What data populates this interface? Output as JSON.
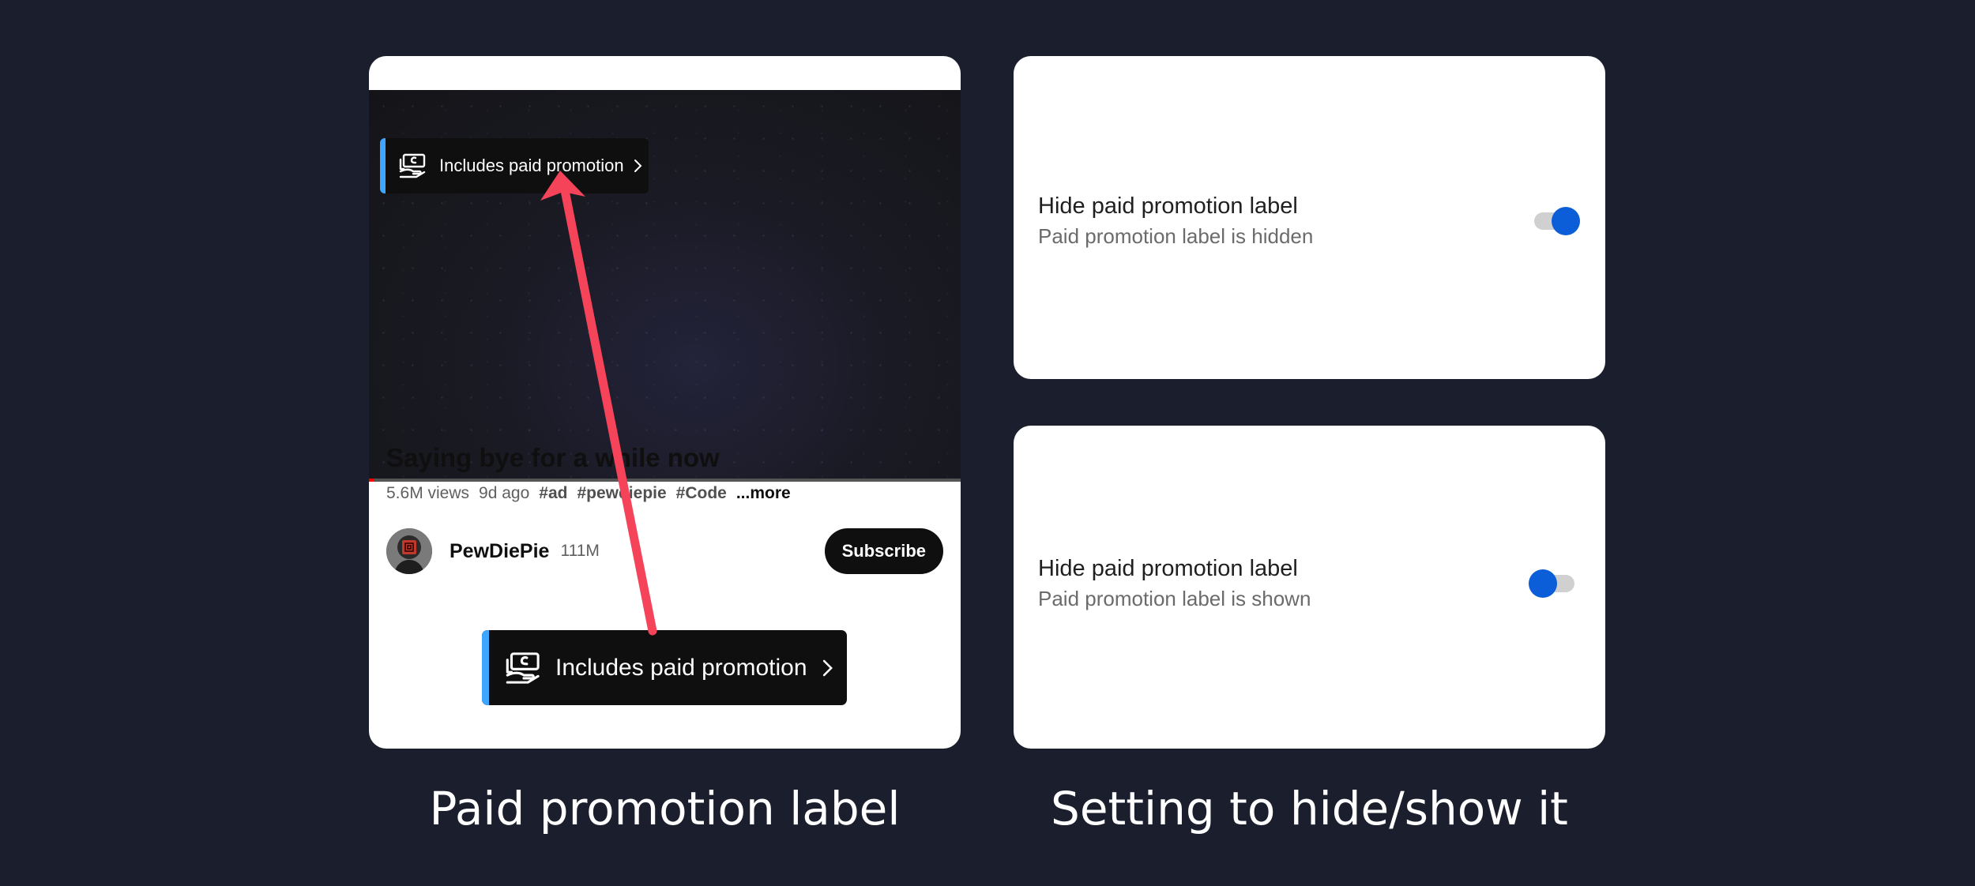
{
  "left_panel": {
    "promo_label": "Includes paid promotion",
    "video": {
      "progress": 0.01,
      "title": "Saying bye for a while now",
      "views": "5.6M views",
      "age": "9d ago",
      "tags": [
        "#ad",
        "#pewdiepie",
        "#Code"
      ],
      "more": "...more"
    },
    "channel": {
      "name": "PewDiePie",
      "subscribers": "111M",
      "subscribe_label": "Subscribe"
    },
    "caption": "Paid promotion label"
  },
  "settings": [
    {
      "title": "Hide paid promotion label",
      "subtitle": "Paid promotion label is hidden",
      "enabled": true
    },
    {
      "title": "Hide paid promotion label",
      "subtitle": "Paid promotion label is shown",
      "enabled": false
    }
  ],
  "right_caption": "Setting to hide/show it",
  "colors": {
    "background": "#1b1f2d",
    "accent_blue": "#3ea6ff",
    "toggle_blue": "#0b5ed7",
    "arrow": "#f5445a"
  }
}
